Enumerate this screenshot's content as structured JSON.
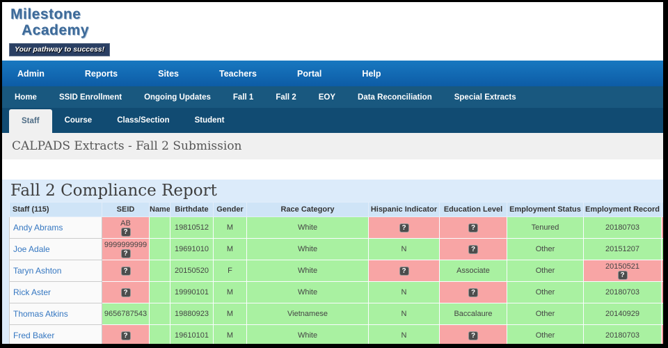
{
  "brand": {
    "line1": "Milestone",
    "line2": "Academy",
    "tagline": "Your pathway to success!"
  },
  "main_nav": {
    "items": [
      {
        "label": "Admin"
      },
      {
        "label": "Reports"
      },
      {
        "label": "Sites"
      },
      {
        "label": "Teachers"
      },
      {
        "label": "Portal"
      },
      {
        "label": "Help"
      }
    ]
  },
  "sub_nav": {
    "items": [
      {
        "label": "Home"
      },
      {
        "label": "SSID Enrollment"
      },
      {
        "label": "Ongoing Updates"
      },
      {
        "label": "Fall 1"
      },
      {
        "label": "Fall 2"
      },
      {
        "label": "EOY"
      },
      {
        "label": "Data Reconciliation"
      },
      {
        "label": "Special Extracts"
      }
    ]
  },
  "tabs": {
    "items": [
      {
        "label": "Staff",
        "active": true
      },
      {
        "label": "Course",
        "active": false
      },
      {
        "label": "Class/Section",
        "active": false
      },
      {
        "label": "Student",
        "active": false
      }
    ]
  },
  "page": {
    "title": "CALPADS Extracts - Fall 2 Submission"
  },
  "report": {
    "heading": "Fall 2 Compliance Report"
  },
  "colors": {
    "nav_blue": "#0d5ca6",
    "subnav_blue": "#19587f",
    "tab_blue": "#114b72",
    "band_blue": "#dcebfa",
    "header_blue": "#cfe4f7",
    "ok_green": "#a9f1a1",
    "error_red": "#f8a5a5",
    "link_blue": "#3577c1"
  },
  "table": {
    "icon_label": "?",
    "columns": [
      "Staff (115)",
      "SEID",
      "Name",
      "Birthdate",
      "Gender",
      "Race Category",
      "Hispanic Indicator",
      "Education Level",
      "Employment Status",
      "Employment Record"
    ],
    "rows": [
      {
        "name": "Andy Abrams",
        "edge": "red",
        "cells": [
          {
            "key": "seid",
            "color": "red",
            "text": "AB",
            "icon": true
          },
          {
            "key": "name",
            "color": "green",
            "text": ""
          },
          {
            "key": "birthdate",
            "color": "green",
            "text": "19810512"
          },
          {
            "key": "gender",
            "color": "green",
            "text": "M"
          },
          {
            "key": "race-category",
            "color": "green",
            "text": "White"
          },
          {
            "key": "hispanic-indicator",
            "color": "red",
            "text": "",
            "icon": true
          },
          {
            "key": "education-level",
            "color": "red",
            "text": "",
            "icon": true
          },
          {
            "key": "employment-status",
            "color": "green",
            "text": "Tenured"
          },
          {
            "key": "employment-record",
            "color": "green",
            "text": "20180703"
          }
        ]
      },
      {
        "name": "Joe Adale",
        "edge": "green",
        "cells": [
          {
            "key": "seid",
            "color": "red",
            "text": "9999999999",
            "icon": true
          },
          {
            "key": "name",
            "color": "green",
            "text": ""
          },
          {
            "key": "birthdate",
            "color": "green",
            "text": "19691010"
          },
          {
            "key": "gender",
            "color": "green",
            "text": "M"
          },
          {
            "key": "race-category",
            "color": "green",
            "text": "White"
          },
          {
            "key": "hispanic-indicator",
            "color": "green",
            "text": "N"
          },
          {
            "key": "education-level",
            "color": "red",
            "text": "",
            "icon": true
          },
          {
            "key": "employment-status",
            "color": "green",
            "text": "Other"
          },
          {
            "key": "employment-record",
            "color": "green",
            "text": "20151207"
          }
        ]
      },
      {
        "name": "Taryn Ashton",
        "edge": "red",
        "cells": [
          {
            "key": "seid",
            "color": "red",
            "text": "",
            "icon": true
          },
          {
            "key": "name",
            "color": "green",
            "text": ""
          },
          {
            "key": "birthdate",
            "color": "green",
            "text": "20150520"
          },
          {
            "key": "gender",
            "color": "green",
            "text": "F"
          },
          {
            "key": "race-category",
            "color": "green",
            "text": "White"
          },
          {
            "key": "hispanic-indicator",
            "color": "red",
            "text": "",
            "icon": true
          },
          {
            "key": "education-level",
            "color": "green",
            "text": "Associate"
          },
          {
            "key": "employment-status",
            "color": "green",
            "text": "Other"
          },
          {
            "key": "employment-record",
            "color": "red",
            "text": "20150521",
            "icon": true
          }
        ]
      },
      {
        "name": "Rick Aster",
        "edge": "red",
        "cells": [
          {
            "key": "seid",
            "color": "red",
            "text": "",
            "icon": true
          },
          {
            "key": "name",
            "color": "green",
            "text": ""
          },
          {
            "key": "birthdate",
            "color": "green",
            "text": "19990101"
          },
          {
            "key": "gender",
            "color": "green",
            "text": "M"
          },
          {
            "key": "race-category",
            "color": "green",
            "text": "White"
          },
          {
            "key": "hispanic-indicator",
            "color": "green",
            "text": "N"
          },
          {
            "key": "education-level",
            "color": "red",
            "text": "",
            "icon": true
          },
          {
            "key": "employment-status",
            "color": "green",
            "text": "Other"
          },
          {
            "key": "employment-record",
            "color": "green",
            "text": "20180703"
          }
        ]
      },
      {
        "name": "Thomas Atkins",
        "edge": "green",
        "cells": [
          {
            "key": "seid",
            "color": "green",
            "text": "9656787543"
          },
          {
            "key": "name",
            "color": "green",
            "text": ""
          },
          {
            "key": "birthdate",
            "color": "green",
            "text": "19880923"
          },
          {
            "key": "gender",
            "color": "green",
            "text": "M"
          },
          {
            "key": "race-category",
            "color": "green",
            "text": "Vietnamese"
          },
          {
            "key": "hispanic-indicator",
            "color": "green",
            "text": "N"
          },
          {
            "key": "education-level",
            "color": "green",
            "text": "Baccalaure"
          },
          {
            "key": "employment-status",
            "color": "green",
            "text": "Other"
          },
          {
            "key": "employment-record",
            "color": "green",
            "text": "20140929"
          }
        ]
      },
      {
        "name": "Fred Baker",
        "edge": "red",
        "cells": [
          {
            "key": "seid",
            "color": "red",
            "text": "",
            "icon": true
          },
          {
            "key": "name",
            "color": "green",
            "text": ""
          },
          {
            "key": "birthdate",
            "color": "green",
            "text": "19610101"
          },
          {
            "key": "gender",
            "color": "green",
            "text": "M"
          },
          {
            "key": "race-category",
            "color": "green",
            "text": "White"
          },
          {
            "key": "hispanic-indicator",
            "color": "green",
            "text": "N"
          },
          {
            "key": "education-level",
            "color": "red",
            "text": "",
            "icon": true
          },
          {
            "key": "employment-status",
            "color": "green",
            "text": "Other"
          },
          {
            "key": "employment-record",
            "color": "green",
            "text": "20180703"
          }
        ]
      }
    ]
  }
}
